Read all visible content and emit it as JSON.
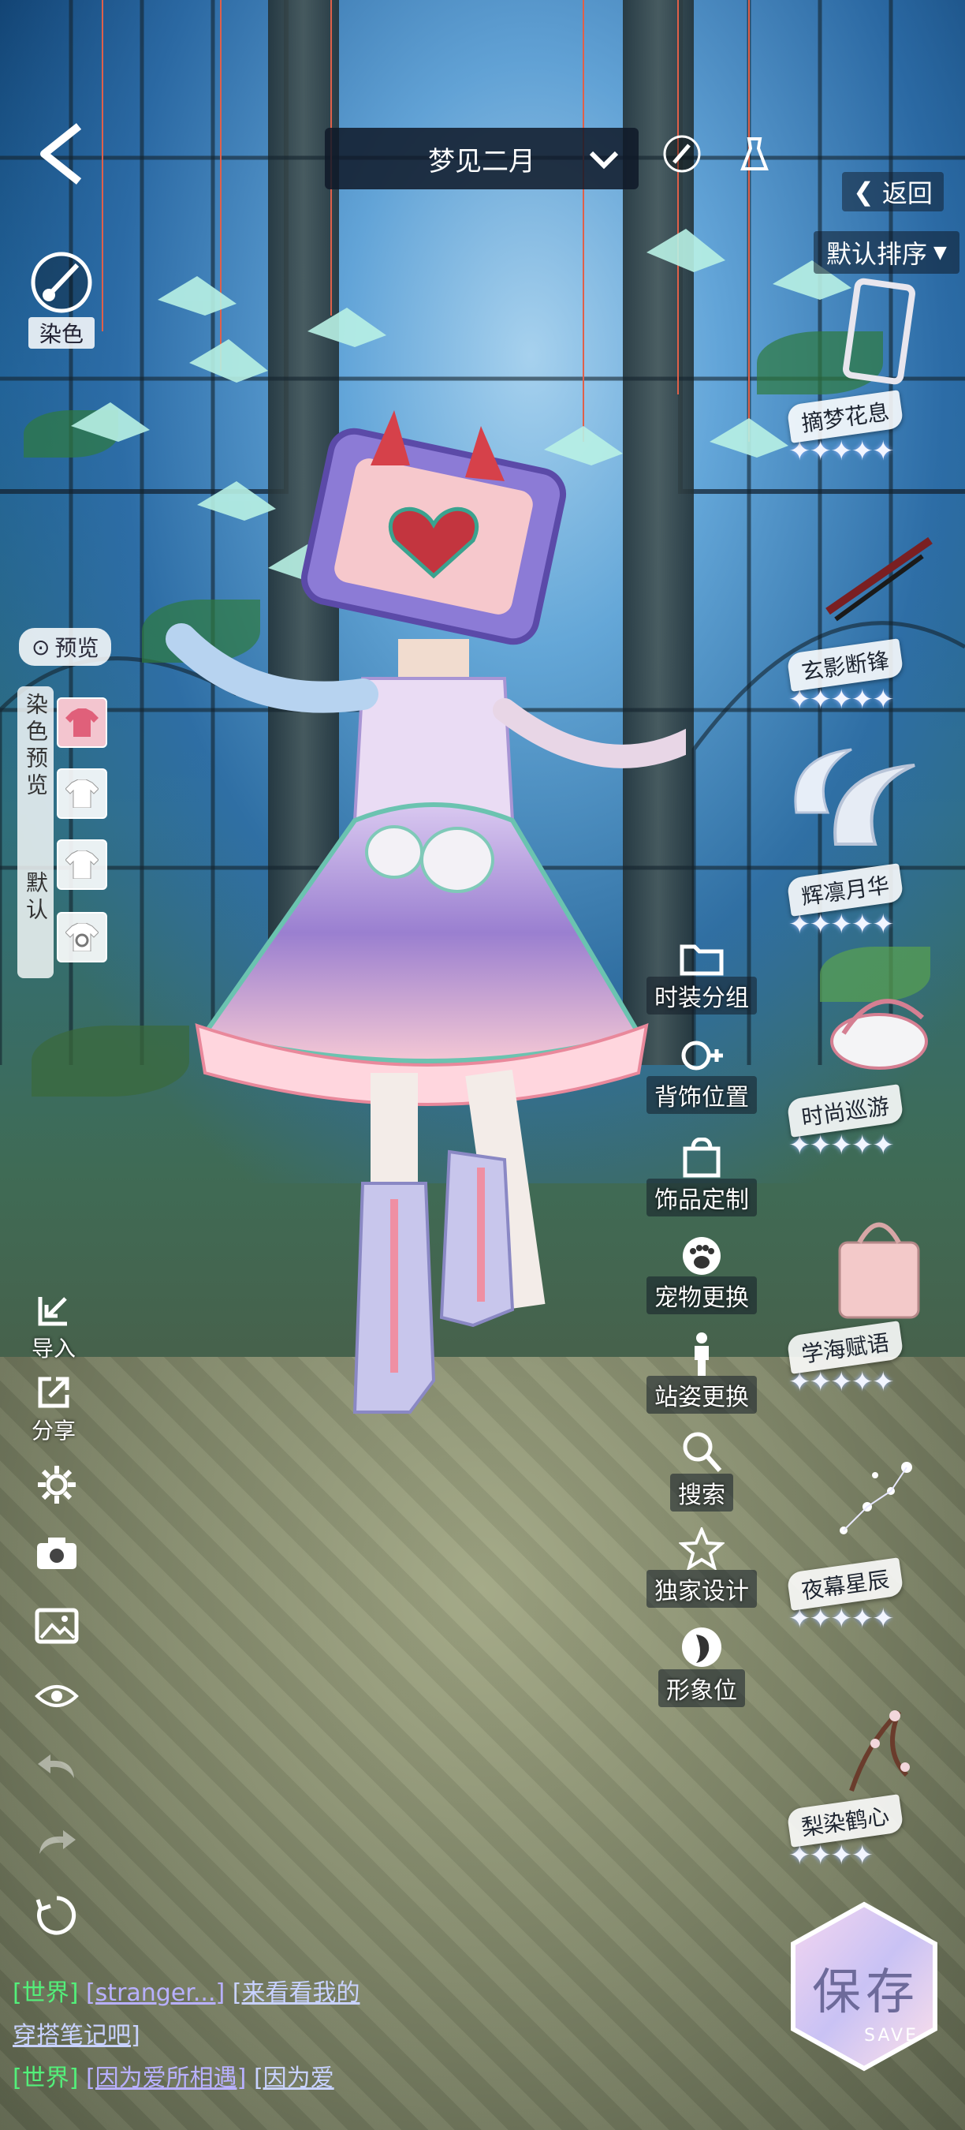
{
  "header": {
    "outfit_name": "梦见二月",
    "back_label": "返回",
    "sort_label": "默认排序"
  },
  "left_panel": {
    "dye_label": "染色",
    "preview_label": "预览",
    "dye_preview_label": "染色预览",
    "default_label": "默认",
    "import_label": "导入",
    "share_label": "分享"
  },
  "mid_menu": [
    {
      "label": "时装分组",
      "icon": "folder-icon"
    },
    {
      "label": "背饰位置",
      "icon": "position-icon"
    },
    {
      "label": "饰品定制",
      "icon": "accessory-icon"
    },
    {
      "label": "宠物更换",
      "icon": "paw-icon"
    },
    {
      "label": "站姿更换",
      "icon": "pose-icon"
    },
    {
      "label": "搜索",
      "icon": "search-icon"
    },
    {
      "label": "独家设计",
      "icon": "star-icon"
    },
    {
      "label": "形象位",
      "icon": "portrait-icon"
    }
  ],
  "items": [
    {
      "name": "摘梦花息",
      "stars": 5
    },
    {
      "name": "玄影断锋",
      "stars": 5
    },
    {
      "name": "辉凛月华",
      "stars": 5
    },
    {
      "name": "时尚巡游",
      "stars": 5
    },
    {
      "name": "学海赋语",
      "stars": 5
    },
    {
      "name": "夜幕星辰",
      "stars": 5
    },
    {
      "name": "梨染鹤心",
      "stars": 4
    }
  ],
  "save": {
    "label": "保存",
    "sub_label": "SAVE"
  },
  "chat": [
    {
      "channel": "[世界]",
      "name": "[stranger...]",
      "text": "[来看看我的",
      "text2": "穿搭笔记吧]"
    },
    {
      "channel": "[世界]",
      "name": "[因为爱所相遇]",
      "text": "[因为爱"
    }
  ],
  "colors": {
    "accent_green": "#53f07a",
    "label_bg": "#ffffff",
    "topbar_bg": "#0f1928"
  }
}
